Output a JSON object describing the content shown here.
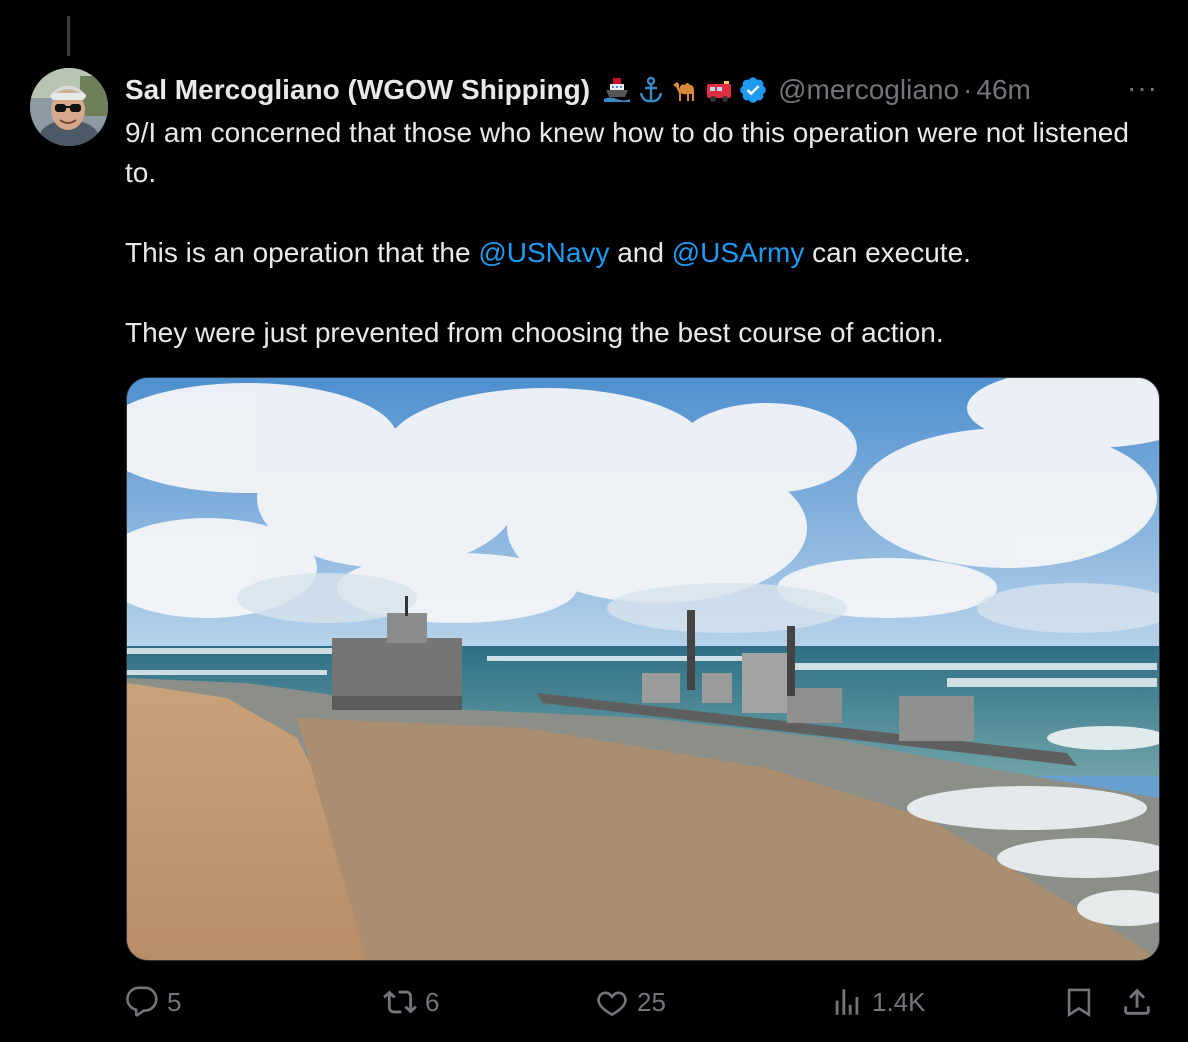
{
  "tweet": {
    "author_name": "Sal Mercogliano (WGOW Shipping)",
    "author_emojis": [
      "ship-emoji",
      "anchor-emoji",
      "camel-emoji",
      "fire-engine-emoji"
    ],
    "verified": true,
    "handle": "@mercogliano",
    "separator": "·",
    "time": "46m",
    "more_label": "···",
    "text_line1_pre": "9/I am concerned that those who knew how to do this operation were not listened to.",
    "text_line2_pre": "This is an operation that the ",
    "mention1": "@USNavy",
    "text_line2_mid": " and ",
    "mention2": "@USArmy",
    "text_line2_post": " can execute.",
    "text_line3": "They were just prevented from choosing the best course of action."
  },
  "actions": {
    "reply_count": "5",
    "retweet_count": "6",
    "like_count": "25",
    "view_count": "1.4K"
  },
  "colors": {
    "background": "#000000",
    "text_primary": "#e7e9ea",
    "text_secondary": "#71767b",
    "link": "#1d9bf0",
    "verified": "#1d9bf0"
  }
}
